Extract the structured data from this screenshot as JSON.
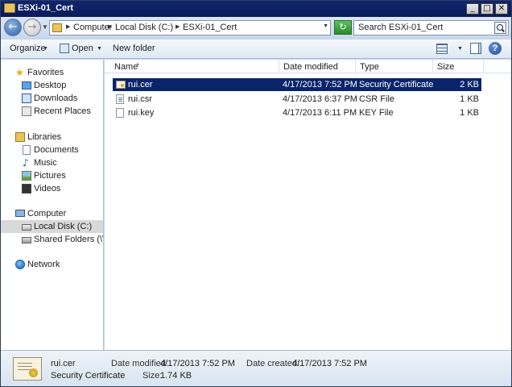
{
  "window": {
    "title": "ESXi-01_Cert"
  },
  "address": {
    "crumbs": [
      "Computer",
      "Local Disk (C:)",
      "ESXi-01_Cert"
    ]
  },
  "search": {
    "placeholder": "Search ESXi-01_Cert"
  },
  "toolbar": {
    "organize": "Organize",
    "open": "Open",
    "new_folder": "New folder"
  },
  "nav": {
    "favorites": {
      "label": "Favorites",
      "items": [
        "Desktop",
        "Downloads",
        "Recent Places"
      ]
    },
    "libraries": {
      "label": "Libraries",
      "items": [
        "Documents",
        "Music",
        "Pictures",
        "Videos"
      ]
    },
    "computer": {
      "label": "Computer",
      "items": [
        "Local Disk (C:)",
        "Shared Folders (\\\\vmw"
      ]
    },
    "network": {
      "label": "Network"
    }
  },
  "columns": {
    "name": "Name",
    "date": "Date modified",
    "type": "Type",
    "size": "Size"
  },
  "files": [
    {
      "name": "rui.cer",
      "date": "4/17/2013 7:52 PM",
      "type": "Security Certificate",
      "size": "2 KB",
      "icon": "certificate-icon",
      "selected": true
    },
    {
      "name": "rui.csr",
      "date": "4/17/2013 6:37 PM",
      "type": "CSR File",
      "size": "1 KB",
      "icon": "text-file-icon",
      "selected": false
    },
    {
      "name": "rui.key",
      "date": "4/17/2013 6:11 PM",
      "type": "KEY File",
      "size": "1 KB",
      "icon": "blank-file-icon",
      "selected": false
    }
  ],
  "details": {
    "name": "rui.cer",
    "type": "Security Certificate",
    "modified_label": "Date modified:",
    "modified_value": "4/17/2013 7:52 PM",
    "created_label": "Date created:",
    "created_value": "4/17/2013 7:52 PM",
    "size_label": "Size:",
    "size_value": "1.74 KB"
  },
  "colors": {
    "titlebar": "#10246f",
    "selection": "#0a246a",
    "chrome": "#c7d6ea"
  }
}
